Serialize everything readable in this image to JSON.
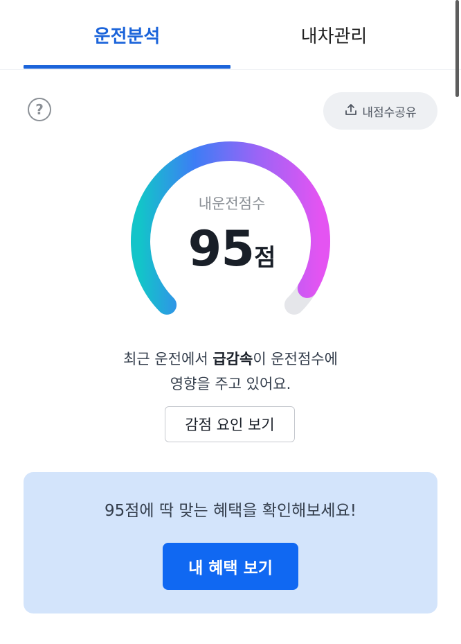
{
  "tabs": [
    {
      "label": "운전분석",
      "active": true
    },
    {
      "label": "내차관리",
      "active": false
    }
  ],
  "header": {
    "share_label": "내점수공유",
    "help_symbol": "?"
  },
  "score": {
    "label": "내운전점수",
    "value": "95",
    "unit": "점",
    "gauge_fraction": 0.95,
    "gradient_colors": [
      "#13c4c9",
      "#3d7df5",
      "#9b64f6",
      "#e454f2"
    ],
    "track_color": "#e5e6ea"
  },
  "message": {
    "line1_prefix": "최근 운전에서 ",
    "line1_bold": "급감속",
    "line1_suffix": "이 운전점수에",
    "line2": "영향을 주고 있어요."
  },
  "deduction_button": "감점 요인 보기",
  "benefit": {
    "text": "95점에 딱 맞는 혜택을 확인해보세요!",
    "button": "내 혜택 보기"
  },
  "icons": {
    "help": "question-circle-icon",
    "share": "share-upload-icon"
  },
  "colors": {
    "accent": "#1b64da",
    "button": "#1068f2",
    "card_bg": "#d3e4fb"
  }
}
